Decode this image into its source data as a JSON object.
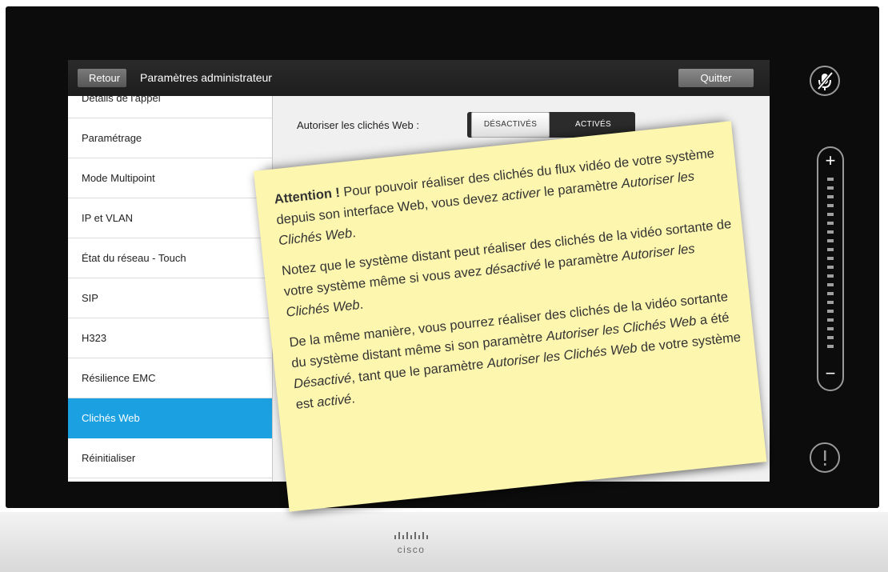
{
  "header": {
    "back_label": "Retour",
    "title": "Paramètres administrateur",
    "quit_label": "Quitter"
  },
  "sidebar": {
    "items": [
      {
        "label": "Détails de l'appel"
      },
      {
        "label": "Paramétrage"
      },
      {
        "label": "Mode Multipoint"
      },
      {
        "label": "IP et VLAN"
      },
      {
        "label": "État du réseau - Touch"
      },
      {
        "label": "SIP"
      },
      {
        "label": "H323"
      },
      {
        "label": "Résilience EMC"
      },
      {
        "label": "Clichés Web",
        "active": true
      },
      {
        "label": "Réinitialiser"
      }
    ]
  },
  "setting": {
    "label": "Autoriser les clichés Web :",
    "off_label": "DÉSACTIVÉS",
    "on_label": "ACTIVÉS",
    "selected": "DÉSACTIVÉS"
  },
  "note": {
    "p1_bold": "Attention !",
    "p1_a": " Pour pouvoir réaliser des clichés du flux vidéo de votre système depuis son interface Web, vous devez ",
    "p1_em1": "activer",
    "p1_b": " le paramètre ",
    "p1_em2": "Autoriser les Clichés Web",
    "p1_c": ".",
    "p2_a": "Notez que le système distant peut réaliser des clichés de la vidéo sortante de votre système même si vous avez ",
    "p2_em1": "désactivé",
    "p2_b": " le paramètre ",
    "p2_em2": "Autoriser les Clichés Web",
    "p2_c": ".",
    "p3_a": "De la même manière, vous pourrez réaliser des clichés de la vidéo sortante du système distant même si son paramètre ",
    "p3_em1": "Autoriser les Clichés Web",
    "p3_b": " a été ",
    "p3_em2": "Désactivé",
    "p3_c": ", tant que le paramètre ",
    "p3_em3": "Autoriser les Clichés Web",
    "p3_d": " de votre système est ",
    "p3_em4": "activé",
    "p3_e": "."
  },
  "footer": {
    "brand": "cisco"
  },
  "icons": {
    "mute": "microphone-muted-icon",
    "info": "exclamation-icon",
    "volume_plus": "+",
    "volume_minus": "−"
  },
  "colors": {
    "accent": "#1ba0e1",
    "note": "#fdf6ae"
  }
}
